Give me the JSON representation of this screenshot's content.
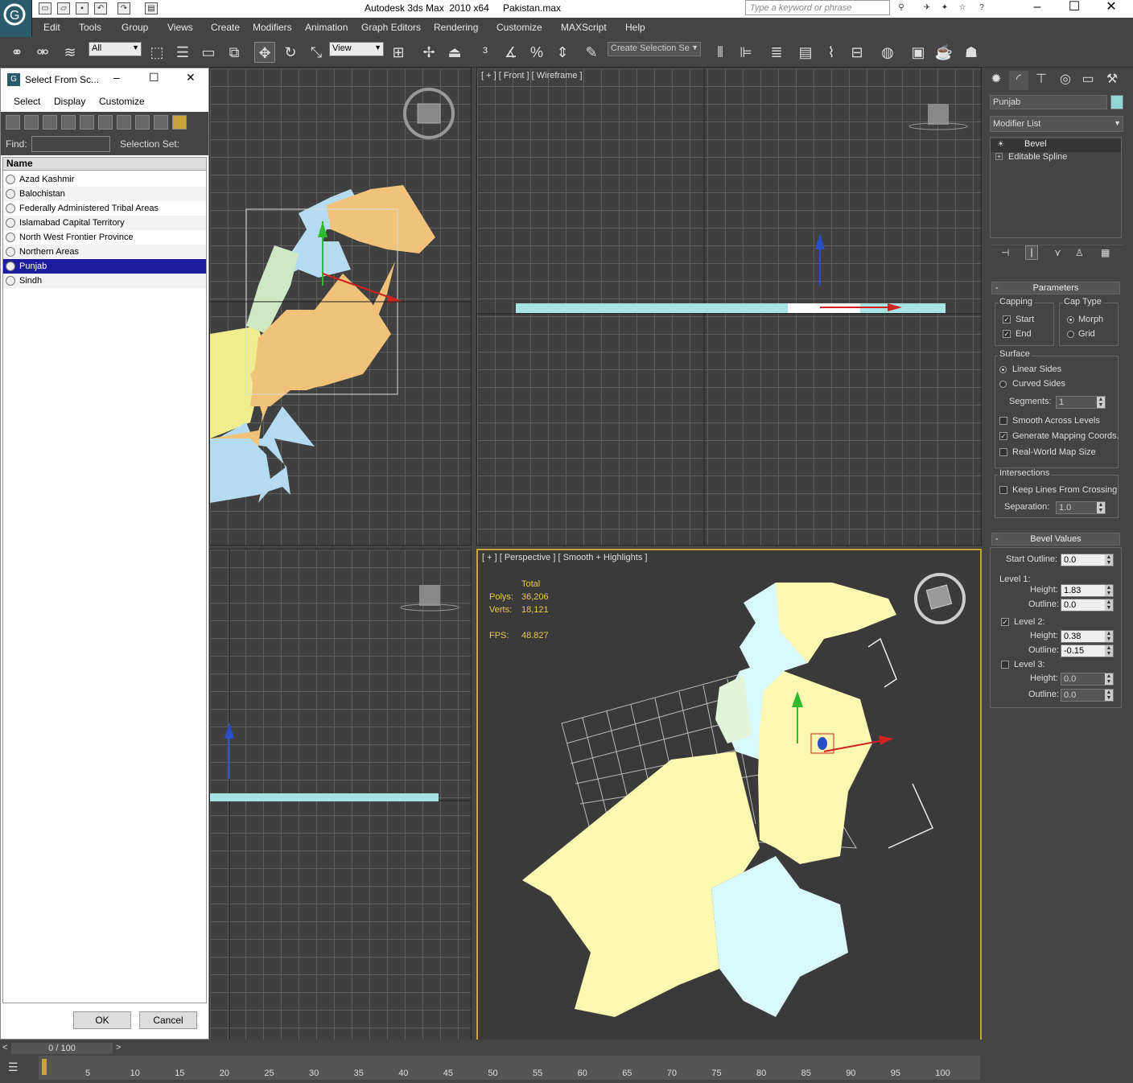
{
  "window": {
    "title": "Autodesk 3ds Max  2010 x64",
    "file": "Pakistan.max",
    "search_placeholder": "Type a keyword or phrase"
  },
  "menu": [
    "Edit",
    "Tools",
    "Group",
    "Views",
    "Create",
    "Modifiers",
    "Animation",
    "Graph Editors",
    "Rendering",
    "Customize",
    "MAXScript",
    "Help"
  ],
  "toolbar": {
    "filter": "All",
    "ref_coord": "View",
    "selection_set": "Create Selection Se"
  },
  "dialog": {
    "title": "Select From Sc...",
    "menus": [
      "Select",
      "Display",
      "Customize"
    ],
    "find_label": "Find:",
    "selset_label": "Selection Set:",
    "col_name": "Name",
    "items": [
      "Azad Kashmir",
      "Balochistan",
      "Federally Administered Tribal Areas",
      "Islamabad Capital Territory",
      "North West Frontier Province",
      "Northern Areas",
      "Punjab",
      "Sindh"
    ],
    "selected": "Punjab",
    "ok": "OK",
    "cancel": "Cancel"
  },
  "viewports": {
    "front": "[ + ] [ Front ] [ Wireframe ]",
    "persp": "[ + ] [ Perspective ] [ Smooth + Highlights ]",
    "stats": {
      "total": "Total",
      "polys_label": "Polys:",
      "polys": "36,206",
      "verts_label": "Verts:",
      "verts": "18,121",
      "fps_label": "FPS:",
      "fps": "48.827"
    }
  },
  "command_panel": {
    "object_name": "Punjab",
    "object_color": "#8fd8d8",
    "modifier_list": "Modifier List",
    "stack": [
      "Bevel",
      "Editable Spline"
    ],
    "parameters": {
      "title": "Parameters",
      "capping": "Capping",
      "start": "Start",
      "end": "End",
      "cap_type": "Cap Type",
      "morph": "Morph",
      "grid": "Grid",
      "surface": "Surface",
      "linear": "Linear Sides",
      "curved": "Curved Sides",
      "segments_label": "Segments:",
      "segments": "1",
      "smooth": "Smooth Across Levels",
      "gen_map": "Generate Mapping Coords.",
      "real_world": "Real-World Map Size",
      "intersections": "Intersections",
      "keep_lines": "Keep Lines From Crossing",
      "separation_label": "Separation:",
      "separation": "1.0"
    },
    "bevel": {
      "title": "Bevel Values",
      "start_outline_label": "Start Outline:",
      "start_outline": "0.0",
      "level1": "Level 1:",
      "height_label": "Height:",
      "outline_label": "Outline:",
      "l1_height": "1.83",
      "l1_outline": "0.0",
      "level2": "Level 2:",
      "l2_height": "0.38",
      "l2_outline": "-0.15",
      "level3": "Level 3:",
      "l3_height": "0.0",
      "l3_outline": "0.0"
    }
  },
  "timeline": {
    "frame": "0 / 100",
    "ticks": [
      "5",
      "10",
      "15",
      "20",
      "25",
      "30",
      "35",
      "40",
      "45",
      "50",
      "55",
      "60",
      "65",
      "70",
      "75",
      "80",
      "85",
      "90",
      "95",
      "100"
    ]
  }
}
